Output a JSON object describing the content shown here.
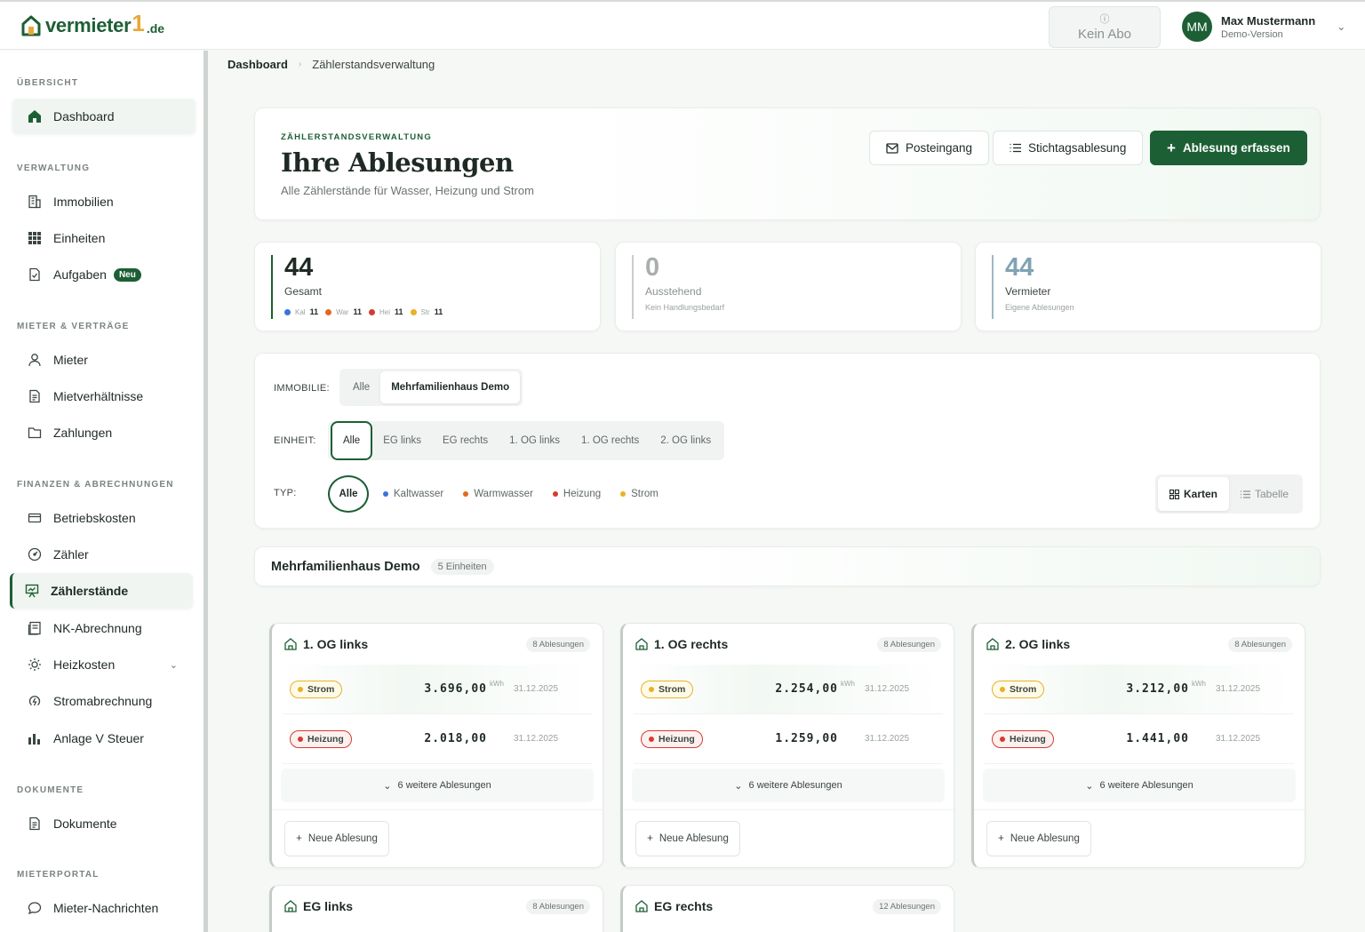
{
  "brand": {
    "name": "vermieter",
    "one": "1",
    "tld": ".de"
  },
  "header": {
    "abo_label": "Kein Abo",
    "user_initials": "MM",
    "user_name": "Max Mustermann",
    "user_role": "Demo-Version"
  },
  "sidebar": {
    "sections": [
      {
        "label": "ÜBERSICHT",
        "items": [
          {
            "label": "Dashboard",
            "icon": "home-icon"
          }
        ]
      },
      {
        "label": "VERWALTUNG",
        "items": [
          {
            "label": "Immobilien",
            "icon": "building-icon"
          },
          {
            "label": "Einheiten",
            "icon": "grid-icon"
          },
          {
            "label": "Aufgaben",
            "icon": "task-icon",
            "badge": "Neu"
          }
        ]
      },
      {
        "label": "MIETER & VERTRÄGE",
        "items": [
          {
            "label": "Mieter",
            "icon": "user-icon"
          },
          {
            "label": "Mietverhältnisse",
            "icon": "document-icon"
          },
          {
            "label": "Zahlungen",
            "icon": "folder-icon"
          }
        ]
      },
      {
        "label": "FINANZEN & ABRECHNUNGEN",
        "items": [
          {
            "label": "Betriebskosten",
            "icon": "card-icon"
          },
          {
            "label": "Zähler",
            "icon": "gauge-icon"
          },
          {
            "label": "Zählerstände",
            "icon": "chart-board-icon"
          },
          {
            "label": "NK-Abrechnung",
            "icon": "receipt-icon"
          },
          {
            "label": "Heizkosten",
            "icon": "sun-icon"
          },
          {
            "label": "Stromabrechnung",
            "icon": "power-icon"
          },
          {
            "label": "Anlage V Steuer",
            "icon": "bar-chart-icon"
          }
        ]
      },
      {
        "label": "DOKUMENTE",
        "items": [
          {
            "label": "Dokumente",
            "icon": "document-icon"
          }
        ]
      },
      {
        "label": "MIETERPORTAL",
        "items": [
          {
            "label": "Mieter-Nachrichten",
            "icon": "chat-icon"
          }
        ]
      }
    ]
  },
  "breadcrumb": {
    "root": "Dashboard",
    "current": "Zählerstandsverwaltung"
  },
  "hero": {
    "kicker": "ZÄHLERSTANDSVERWALTUNG",
    "title": "Ihre Ablesungen",
    "subtitle": "Alle Zählerstände für Wasser, Heizung und Strom",
    "btn_inbox": "Posteingang",
    "btn_stichtag": "Stichtagsablesung",
    "btn_add": "Ablesung erfassen"
  },
  "stats": {
    "total": {
      "value": "44",
      "label": "Gesamt",
      "breakdown": [
        {
          "abbr": "Kal",
          "count": "11",
          "color": "#3b73d9"
        },
        {
          "abbr": "War",
          "count": "11",
          "color": "#e3691f"
        },
        {
          "abbr": "Hei",
          "count": "11",
          "color": "#d63a31"
        },
        {
          "abbr": "Str",
          "count": "11",
          "color": "#e8b128"
        }
      ]
    },
    "pending": {
      "value": "0",
      "label": "Ausstehend",
      "sub": "Kein Handlungsbedarf"
    },
    "owner": {
      "value": "44",
      "label": "Vermieter",
      "sub": "Eigene Ablesungen"
    }
  },
  "filters": {
    "immobilie_label": "IMMOBILIE:",
    "immobilie_options": [
      "Alle",
      "Mehrfamilienhaus Demo"
    ],
    "einheit_label": "EINHEIT:",
    "einheit_options": [
      "Alle",
      "EG links",
      "EG rechts",
      "1. OG links",
      "1. OG rechts",
      "2. OG links"
    ],
    "typ_label": "TYP:",
    "typ_all": "Alle",
    "typ_options": [
      {
        "label": "Kaltwasser",
        "color": "#3b73d9"
      },
      {
        "label": "Warmwasser",
        "color": "#e3691f"
      },
      {
        "label": "Heizung",
        "color": "#d63a31"
      },
      {
        "label": "Strom",
        "color": "#e8b128"
      }
    ],
    "view_cards": "Karten",
    "view_table": "Tabelle"
  },
  "group": {
    "name": "Mehrfamilienhaus Demo",
    "count": "5 Einheiten"
  },
  "units": [
    {
      "name": "1. OG links",
      "count": "8 Ablesungen",
      "rows": [
        {
          "type": "Strom",
          "color": "#e8b128",
          "value": "3.696,00",
          "unit": "kWh",
          "date": "31.12.2025"
        },
        {
          "type": "Heizung",
          "color": "#d63a31",
          "value": "2.018,00",
          "unit": "",
          "date": "31.12.2025"
        }
      ],
      "more": "6 weitere Ablesungen",
      "add": "Neue Ablesung"
    },
    {
      "name": "1. OG rechts",
      "count": "8 Ablesungen",
      "rows": [
        {
          "type": "Strom",
          "color": "#e8b128",
          "value": "2.254,00",
          "unit": "kWh",
          "date": "31.12.2025"
        },
        {
          "type": "Heizung",
          "color": "#d63a31",
          "value": "1.259,00",
          "unit": "",
          "date": "31.12.2025"
        }
      ],
      "more": "6 weitere Ablesungen",
      "add": "Neue Ablesung"
    },
    {
      "name": "2. OG links",
      "count": "8 Ablesungen",
      "rows": [
        {
          "type": "Strom",
          "color": "#e8b128",
          "value": "3.212,00",
          "unit": "kWh",
          "date": "31.12.2025"
        },
        {
          "type": "Heizung",
          "color": "#d63a31",
          "value": "1.441,00",
          "unit": "",
          "date": "31.12.2025"
        }
      ],
      "more": "6 weitere Ablesungen",
      "add": "Neue Ablesung"
    },
    {
      "name": "EG links",
      "count": "8 Ablesungen"
    },
    {
      "name": "EG rechts",
      "count": "12 Ablesungen"
    }
  ],
  "colors": {
    "brand": "#1d5f35",
    "accent": "#e8a93b"
  }
}
